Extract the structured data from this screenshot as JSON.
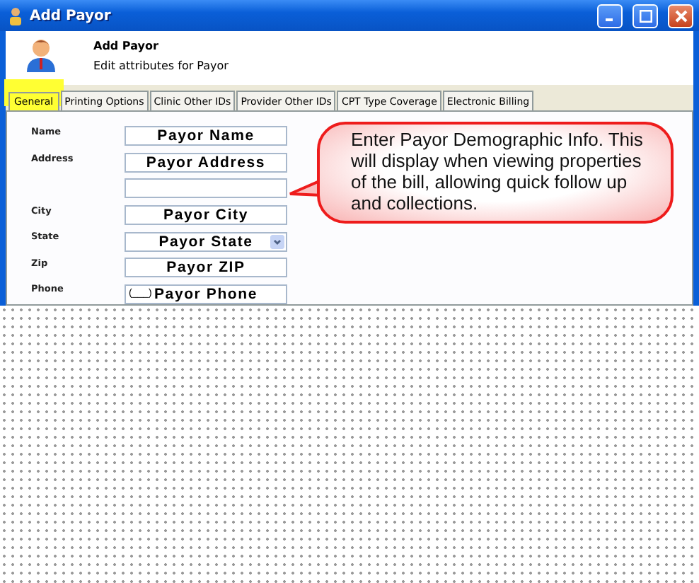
{
  "window": {
    "title": "Add Payor"
  },
  "header": {
    "title": "Add Payor",
    "subtitle": "Edit attributes for Payor"
  },
  "tabs": [
    {
      "label": "General",
      "selected": true,
      "highlighted": true
    },
    {
      "label": "Printing Options",
      "selected": false,
      "highlighted": false
    },
    {
      "label": "Clinic Other IDs",
      "selected": false,
      "highlighted": false
    },
    {
      "label": "Provider Other IDs",
      "selected": false,
      "highlighted": false
    },
    {
      "label": "CPT Type Coverage",
      "selected": false,
      "highlighted": false
    },
    {
      "label": "Electronic Billing",
      "selected": false,
      "highlighted": false
    }
  ],
  "fields": [
    {
      "kind": "text",
      "label": "Name",
      "value": "Payor Name"
    },
    {
      "kind": "text",
      "label": "Address",
      "value": "Payor Address"
    },
    {
      "kind": "text"
    },
    {
      "kind": "text",
      "label": "City",
      "value": "Payor City"
    },
    {
      "kind": "select",
      "label": "State",
      "value": "Payor State"
    },
    {
      "kind": "text",
      "label": "Zip",
      "value": "Payor ZIP"
    },
    {
      "kind": "phone",
      "label": "Phone",
      "mask": "(___)",
      "value": "Payor Phone"
    }
  ],
  "callout": {
    "text": "Enter Payor Demographic Info.  This will display when viewing properties of the bill, allowing quick follow up and collections."
  }
}
